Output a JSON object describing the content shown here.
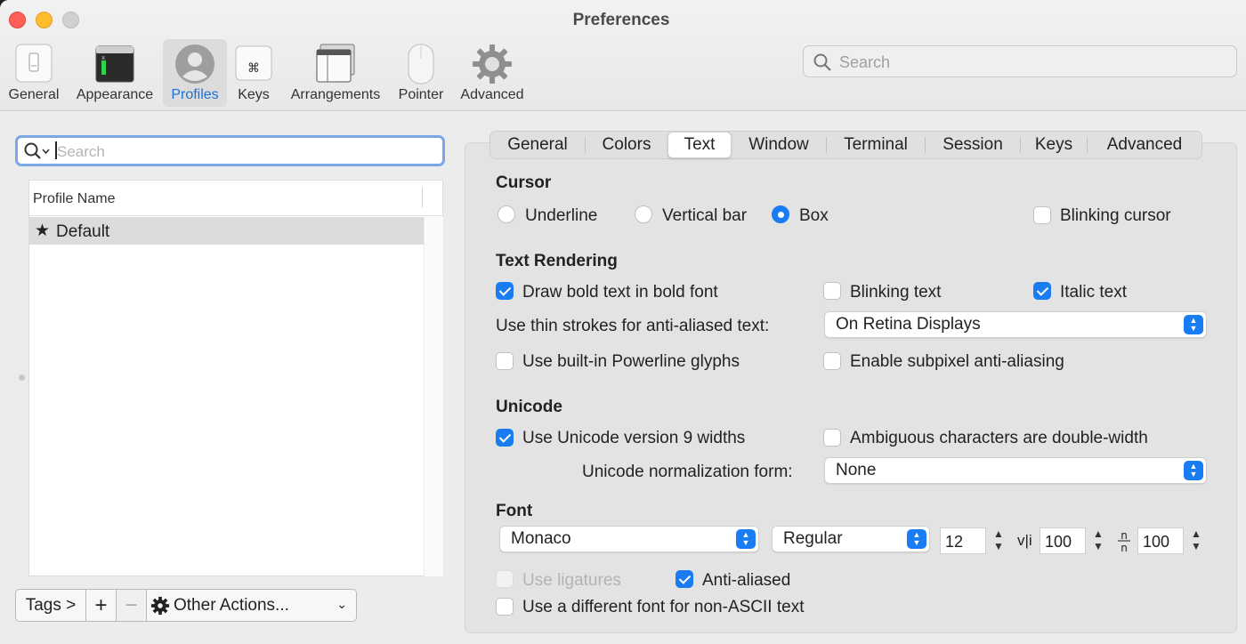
{
  "window": {
    "title": "Preferences"
  },
  "toolbar": {
    "items": [
      {
        "label": "General",
        "icon": "general-switch-icon"
      },
      {
        "label": "Appearance",
        "icon": "terminal-window-icon"
      },
      {
        "label": "Profiles",
        "icon": "person-icon",
        "selected": true
      },
      {
        "label": "Keys",
        "icon": "command-key-icon"
      },
      {
        "label": "Arrangements",
        "icon": "window-arrangement-icon"
      },
      {
        "label": "Pointer",
        "icon": "mouse-icon"
      },
      {
        "label": "Advanced",
        "icon": "gear-icon"
      }
    ],
    "search_placeholder": "Search"
  },
  "left": {
    "search_placeholder": "Search",
    "table_header": "Profile Name",
    "profiles": [
      {
        "name": "Default",
        "star": "★"
      }
    ],
    "bottom": {
      "tags": "Tags >",
      "add": "+",
      "remove": "−",
      "other": "Other Actions...",
      "other_icon": "gear-icon"
    }
  },
  "tabs": {
    "items": [
      "General",
      "Colors",
      "Text",
      "Window",
      "Terminal",
      "Session",
      "Keys",
      "Advanced"
    ],
    "active": "Text"
  },
  "cursor": {
    "heading": "Cursor",
    "underline": "Underline",
    "vertical_bar": "Vertical bar",
    "box": "Box",
    "selected": "Box",
    "blinking_cursor": "Blinking cursor",
    "blinking_cursor_checked": false
  },
  "text_rendering": {
    "heading": "Text Rendering",
    "draw_bold": "Draw bold text in bold font",
    "draw_bold_checked": true,
    "blinking_text": "Blinking text",
    "blinking_text_checked": false,
    "italic_text": "Italic text",
    "italic_text_checked": true,
    "thin_strokes_label": "Use thin strokes for anti-aliased text:",
    "thin_strokes_value": "On Retina Displays",
    "powerline": "Use built-in Powerline glyphs",
    "powerline_checked": false,
    "subpixel": "Enable subpixel anti-aliasing",
    "subpixel_checked": false
  },
  "unicode": {
    "heading": "Unicode",
    "v9_widths": "Use Unicode version 9 widths",
    "v9_widths_checked": true,
    "ambiguous": "Ambiguous characters are double-width",
    "ambiguous_checked": false,
    "normalization_label": "Unicode normalization form:",
    "normalization_value": "None"
  },
  "font": {
    "heading": "Font",
    "family": "Monaco",
    "style": "Regular",
    "size": "12",
    "h_spacing_icon": "v|i",
    "h_spacing": "100",
    "v_spacing_icon": "n/n",
    "v_spacing": "100",
    "ligatures": "Use ligatures",
    "ligatures_checked": false,
    "anti_aliased": "Anti-aliased",
    "anti_aliased_checked": true,
    "non_ascii": "Use a different font for non-ASCII text",
    "non_ascii_checked": false
  },
  "colors": {
    "accent": "#1a7cf2",
    "selected_toolbar_label": "#1a6fd8"
  }
}
